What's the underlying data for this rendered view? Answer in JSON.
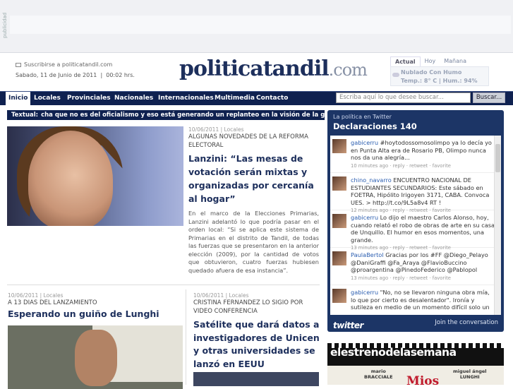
{
  "ad": {
    "label": "publicidad"
  },
  "header": {
    "subscribe": "Suscribirse a politicatandil.com",
    "date": "Sabado, 11 de Junio de 2011",
    "time": "00:02 hrs.",
    "logo_main": "politicatandil",
    "logo_domain": ".com"
  },
  "weather": {
    "tabs": [
      "Actual",
      "Hoy",
      "Mañana"
    ],
    "condition": "Nublado Con Humo",
    "temp": "Temp.: 8° C | Hum.: 94%"
  },
  "nav": {
    "items": [
      "Inicio",
      "Locales",
      "Provinciales",
      "Nacionales",
      "Internacionales",
      "Multimedia",
      "Contacto"
    ],
    "search_placeholder": "Escriba aquí lo que desee buscar...",
    "search_button": "Buscar..."
  },
  "ticker": {
    "label": "Textual:",
    "text": "cha que no es del oficialismo y eso está generando un replanteo en la visión de la gente\" /// Cl"
  },
  "lead": {
    "meta": "10/06/2011 | Locales",
    "kicker": "ALGUNAS NOVEDADES DE LA REFORMA ELECTORAL",
    "headline": "Lanzini: “Las mesas de votación serán mixtas y organizadas por cercanía al hogar”",
    "body": "En el marco de la Elecciones Primarias, Lanzini adelantó lo que podría pasar en el orden local: “Si se aplica este sistema de Primarias en el distrito de Tandil, de todas las fuerzas que se presentaron en la anterior elección (2009), por la cantidad de votos que obtuvieron, cuatro fuerzas hubiesen quedado afuera de esa instancia”."
  },
  "story2": {
    "meta": "10/06/2011 | Locales",
    "kicker": "A 13 DIAS DEL LANZAMIENTO",
    "headline": "Esperando un guiño de Lunghi"
  },
  "story3": {
    "meta": "10/06/2011 | Locales",
    "kicker": "CRISTINA FERNANDEZ LO SIGIO POR VIDEO CONFERENCIA",
    "headline": "Satélite que dará datos a investigadores de Unicen y otras universidades se lanzó en EEUU"
  },
  "twitter": {
    "subtitle": "La política en Twitter",
    "title": "Declaraciones 140",
    "tweets": [
      {
        "user": "gabicerru",
        "text": " #hoytodossomosolimpo ya lo decía yo en Punta Alta era de Rosario PB, Olimpo nunca nos da una alegría...",
        "meta": "10 minutes ago · reply · retweet · favorite"
      },
      {
        "user": "chino_navarro",
        "text": " ENCUENTRO NACIONAL DE ESTUDIANTES SECUNDARIOS: Este sábado en FOETRA, Hipólito Irigoyen 3171, CABA. Convoca UES. > http://t.co/9L5a8v4 RT !",
        "meta": "12 minutes ago · reply · retweet · favorite"
      },
      {
        "user": "gabicerru",
        "text": " Lo dijo el maestro Carlos Alonso, hoy, cuando relató el robo de obras de arte en su casa de Unquillo. El humor en esos momentos, una grande.",
        "meta": "13 minutes ago · reply · retweet · favorite"
      },
      {
        "user": "PaulaBertol",
        "text": " Gracias por los #FF @Diego_Pelayo @DaniGraffi @Fa_Araya @FlavioBuccino @proargentina @PinedoFederico @Pablopol",
        "meta": "13 minutes ago · reply · retweet · favorite"
      },
      {
        "user": "gabicerru",
        "text": " \"No, no se llevaron ninguna obra mía, lo que por cierto es desalentador\". Ironía y sutileza en medio de un momento difícil solo un",
        "meta": ""
      }
    ],
    "logo": "twitter",
    "join": "Join the conversation"
  },
  "estreno": {
    "title": "elestrenodelasemana",
    "name1": "mario\nBRACCIALE",
    "name2": "miguel ángel\nLUNGHI",
    "movie": "Mios"
  }
}
